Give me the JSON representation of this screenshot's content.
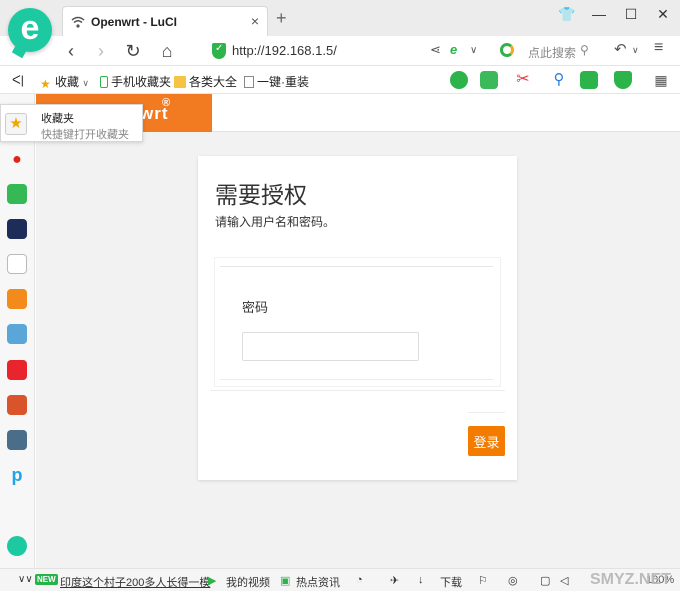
{
  "tab": {
    "title": "Openwrt - LuCI",
    "close": "×",
    "new_tab": "+"
  },
  "window_controls": [
    "👕",
    "—",
    "☐",
    "✕"
  ],
  "nav": {
    "back": "‹",
    "forward": "›",
    "refresh": "↻",
    "home": "⌂",
    "url": "http://192.168.1.5/",
    "search_placeholder": "点此搜索",
    "menu": "≡"
  },
  "bookmarks": {
    "collapse": "ᐸ|",
    "items": [
      "收藏",
      "手机收藏夹",
      "各类大全",
      "一键·重装"
    ]
  },
  "favorites_popup": {
    "title": "收藏夹",
    "hint": "快捷键打开收藏夹"
  },
  "brand": {
    "name": "wrt",
    "reg": "®"
  },
  "login": {
    "title": "需要授权",
    "subtitle": "请输入用户名和密码。",
    "password_label": "密码",
    "password_value": "",
    "submit": "登录"
  },
  "statusbar": {
    "new_badge": "NEW",
    "headline": "印度这个村子200多人长得一模",
    "items": [
      "我的视频",
      "热点资讯",
      "下载"
    ],
    "zoom": "100%",
    "watermark": "SMYZ.NET"
  },
  "colors": {
    "accent": "#f27b00",
    "brand": "#f27b22",
    "app": "#1dc9a0"
  }
}
